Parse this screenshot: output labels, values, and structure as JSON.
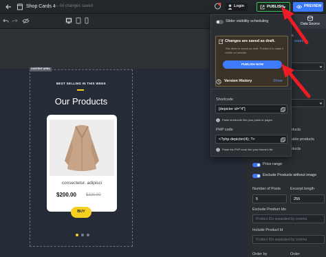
{
  "header": {
    "title": "Shop Cards 4",
    "status": "All changes saved",
    "login_label": "Login",
    "publish_label": "PUBLISH",
    "preview_label": "PREVIEW"
  },
  "right_tabs": {
    "active_fragment": "s",
    "data_source_label": "Data Source",
    "source_link_fragment": "source"
  },
  "popover": {
    "scheduling_label": "Slider visibility scheduling",
    "draft_title": "Changes are saved as draft.",
    "draft_desc": "This slider is saved as draft. Publish it to make it visible on website.",
    "publish_now_label": "PUBLISH NOW",
    "version_history_label": "Version History",
    "version_history_link": "Show",
    "shortcode_label": "Shortcode",
    "shortcode_value": "[depicter id=\"4\"]",
    "shortcode_hint": "Paste shortcode into your posts or pages",
    "php_label": "PHP code",
    "php_value": "<?php depicter(4); ?>",
    "php_hint": "Paste the PHP code into your theme's file"
  },
  "right_panel": {
    "frag1": "ducts",
    "frag2": "able products",
    "frag3": "ducts",
    "price_range_label": "Price range",
    "exclude_label": "Exclude Products without image",
    "num_posts_label": "Number of Posts",
    "num_posts_value": "5",
    "excerpt_label": "Excerpt length",
    "excerpt_value": "255",
    "exclude_ids_label": "Exclude Product Ids",
    "exclude_ids_placeholder": "Product IDs separated by comma",
    "include_ids_label": "Include Product Id",
    "include_ids_placeholder": "Product IDs separated by comma",
    "bottom_left": "Order by",
    "bottom_right": "Order"
  },
  "canvas": {
    "area_label": "CONTENT AREA",
    "kicker": "BEST SELLING IN THIS WEEK",
    "heading": "Our Products",
    "product_name": "consectetur. adipisci",
    "price": "$200.00",
    "old_price": "$220.00",
    "buy_label": "BUY"
  },
  "colors": {
    "publish_green": "#43c463",
    "preview_blue": "#3e7bfa",
    "accent_yellow": "#f5d020",
    "arrow_red": "#ee1c24"
  }
}
